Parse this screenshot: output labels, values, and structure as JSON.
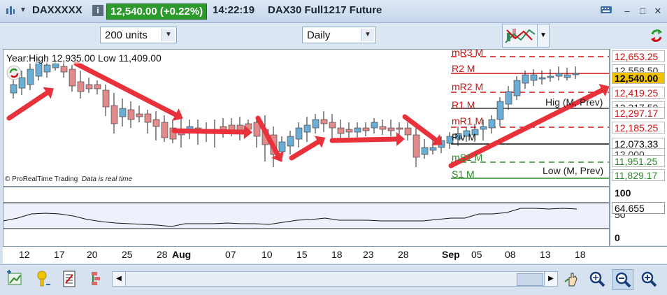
{
  "titlebar": {
    "symbol": "DAXXXXX",
    "info_glyph": "i",
    "price": "12,540.00 (+0.22%)",
    "time": "14:22:19",
    "instrument": "DAX30 Full1217 Future"
  },
  "toolbar": {
    "units_value": "200 units",
    "period_value": "Daily"
  },
  "chart": {
    "header": "Year:High 12,935.00 Low 11,409.00",
    "footer_brand": "© ProRealTime Trading",
    "footer_note": "Data is real time",
    "pivot_labels": {
      "mr3": "mR3 M",
      "r2": "R2 M",
      "mr2": "mR2 M",
      "r1": "R1 M",
      "high_prev": "Hig (M, Prev)",
      "mr1": "mR1 M",
      "piv": "Piv M",
      "ms1": "mS1 M",
      "s1": "S1 M",
      "low_prev": "Low (M, Prev)"
    },
    "price_tags": [
      {
        "value": "12,653.25",
        "color": "#d01010"
      },
      {
        "value": "12,558.50",
        "color": "#333333"
      },
      {
        "value": "12,540.00",
        "color": "#000000",
        "bg": "#f2c200"
      },
      {
        "value": "12,419.25",
        "color": "#d01010"
      },
      {
        "value": "12,317.50",
        "color": "#333333"
      },
      {
        "value": "12,297.17",
        "color": "#d01010"
      },
      {
        "value": "12,185.25",
        "color": "#d01010"
      },
      {
        "value": "12,073.33",
        "color": "#000000"
      },
      {
        "value": "12,000",
        "color": "#333333"
      },
      {
        "value": "11,951.25",
        "color": "#2a8a2a"
      },
      {
        "value": "11,829.17",
        "color": "#2a8a2a"
      }
    ]
  },
  "indicator": {
    "levels": [
      "100",
      "50",
      "0"
    ],
    "value": "64.655"
  },
  "xaxis": {
    "labels": [
      "12",
      "17",
      "20",
      "25",
      "28",
      "Aug",
      "07",
      "10",
      "15",
      "18",
      "23",
      "28",
      "Sep",
      "05",
      "08",
      "13",
      "18"
    ]
  },
  "colors": {
    "up": "#6aaed6",
    "down": "#e08a8a",
    "arrow": "#e8313a",
    "resistance": "#d01010",
    "support": "#2a8a2a"
  },
  "icons": [
    "chart-add-icon",
    "indicator-icon",
    "drawing-list-icon",
    "object-tree-icon",
    "scroll-left-icon",
    "scroll-right-icon",
    "pan-icon",
    "zoom-fit-icon",
    "zoom-out-icon",
    "zoom-in-icon"
  ]
}
